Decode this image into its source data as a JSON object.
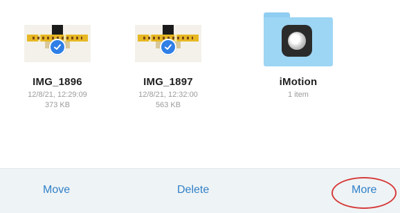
{
  "files": [
    {
      "name": "IMG_1896",
      "date": "12/8/21, 12:29:09",
      "size": "373 KB",
      "selected": true,
      "kind": "image"
    },
    {
      "name": "IMG_1897",
      "date": "12/8/21, 12:32:00",
      "size": "563 KB",
      "selected": true,
      "kind": "image"
    },
    {
      "name": "iMotion",
      "count": "1 item",
      "kind": "folder",
      "icon": "imotion-app-icon"
    }
  ],
  "toolbar": {
    "move_label": "Move",
    "delete_label": "Delete",
    "more_label": "More"
  },
  "colors": {
    "accent": "#2f7fc8",
    "check": "#2f7fe6",
    "folder": "#9dd5f4",
    "annotation": "#d63a3a"
  }
}
